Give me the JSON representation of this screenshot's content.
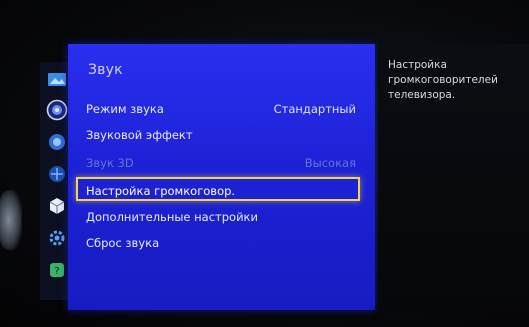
{
  "menu": {
    "title": "Звук",
    "items": [
      {
        "label": "Режим звука",
        "value": "Стандартный",
        "state": "normal"
      },
      {
        "label": "Звуковой эффект",
        "value": "",
        "state": "normal"
      },
      {
        "label": "Звук 3D",
        "value": "Высокая",
        "state": "disabled"
      },
      {
        "label": "Настройка громкоговор.",
        "value": "",
        "state": "selected"
      },
      {
        "label": "Дополнительные настройки",
        "value": "",
        "state": "normal"
      },
      {
        "label": "Сброс звука",
        "value": "",
        "state": "normal"
      }
    ]
  },
  "help": {
    "text": "Настройка\nгромкоговорителей\nтелевизора."
  },
  "rail": {
    "icons": [
      "picture-icon",
      "sound-icon",
      "broadcast-icon",
      "network-icon",
      "system-icon",
      "support-icon",
      "smart-hub-icon"
    ],
    "active": "sound-icon"
  },
  "colors": {
    "panel": "#1d22d6",
    "highlight": "#f1d44a",
    "disabled_text": "#6a72d8"
  }
}
